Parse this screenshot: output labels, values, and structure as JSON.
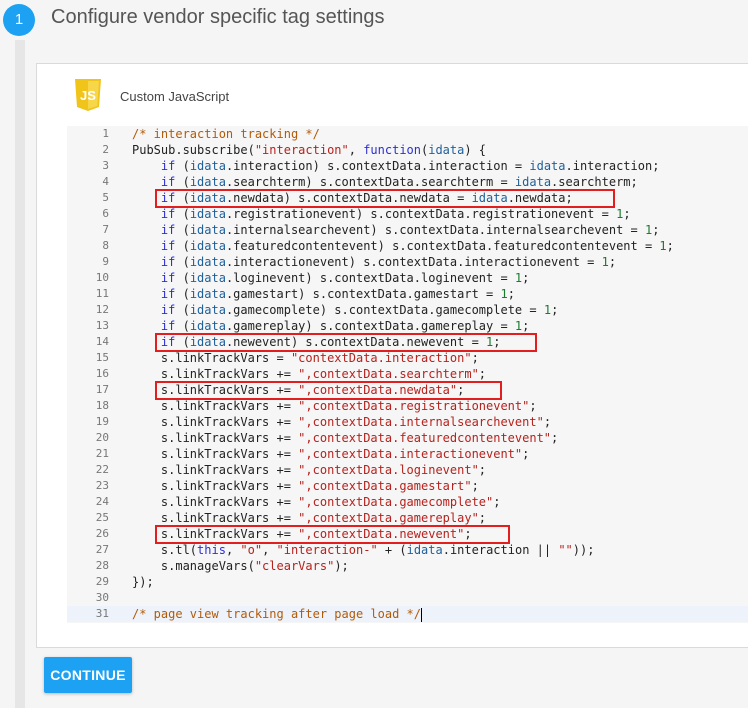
{
  "step": {
    "number": "1",
    "title": "Configure vendor specific tag settings"
  },
  "tag": {
    "icon": "javascript-file-icon",
    "logo_text": "JS",
    "label": "Custom JavaScript"
  },
  "editor": {
    "current_line": 31,
    "highlighted_lines": [
      5,
      14,
      17,
      26
    ],
    "lines": [
      {
        "n": "1",
        "segments": [
          {
            "t": "/* interaction tracking */",
            "c": "com"
          }
        ]
      },
      {
        "n": "2",
        "segments": [
          {
            "t": "PubSub.subscribe(",
            "c": "def"
          },
          {
            "t": "\"interaction\"",
            "c": "str"
          },
          {
            "t": ", ",
            "c": "def"
          },
          {
            "t": "function",
            "c": "kw"
          },
          {
            "t": "(",
            "c": "def"
          },
          {
            "t": "idata",
            "c": "var"
          },
          {
            "t": ") {",
            "c": "def"
          }
        ]
      },
      {
        "n": "3",
        "segments": [
          {
            "t": "    ",
            "c": "def"
          },
          {
            "t": "if",
            "c": "kw"
          },
          {
            "t": " (",
            "c": "def"
          },
          {
            "t": "idata",
            "c": "var"
          },
          {
            "t": ".interaction) s.contextData.interaction = ",
            "c": "def"
          },
          {
            "t": "idata",
            "c": "var"
          },
          {
            "t": ".interaction;",
            "c": "def"
          }
        ]
      },
      {
        "n": "4",
        "segments": [
          {
            "t": "    ",
            "c": "def"
          },
          {
            "t": "if",
            "c": "kw"
          },
          {
            "t": " (",
            "c": "def"
          },
          {
            "t": "idata",
            "c": "var"
          },
          {
            "t": ".searchterm) s.contextData.searchterm = ",
            "c": "def"
          },
          {
            "t": "idata",
            "c": "var"
          },
          {
            "t": ".searchterm;",
            "c": "def"
          }
        ]
      },
      {
        "n": "5",
        "segments": [
          {
            "t": "    ",
            "c": "def"
          },
          {
            "t": "if",
            "c": "kw"
          },
          {
            "t": " (",
            "c": "def"
          },
          {
            "t": "idata",
            "c": "var"
          },
          {
            "t": ".newdata) s.contextData.newdata = ",
            "c": "def"
          },
          {
            "t": "idata",
            "c": "var"
          },
          {
            "t": ".newdata;",
            "c": "def"
          }
        ]
      },
      {
        "n": "6",
        "segments": [
          {
            "t": "    ",
            "c": "def"
          },
          {
            "t": "if",
            "c": "kw"
          },
          {
            "t": " (",
            "c": "def"
          },
          {
            "t": "idata",
            "c": "var"
          },
          {
            "t": ".registrationevent) s.contextData.registrationevent = ",
            "c": "def"
          },
          {
            "t": "1",
            "c": "num"
          },
          {
            "t": ";",
            "c": "def"
          }
        ]
      },
      {
        "n": "7",
        "segments": [
          {
            "t": "    ",
            "c": "def"
          },
          {
            "t": "if",
            "c": "kw"
          },
          {
            "t": " (",
            "c": "def"
          },
          {
            "t": "idata",
            "c": "var"
          },
          {
            "t": ".internalsearchevent) s.contextData.internalsearchevent = ",
            "c": "def"
          },
          {
            "t": "1",
            "c": "num"
          },
          {
            "t": ";",
            "c": "def"
          }
        ]
      },
      {
        "n": "8",
        "segments": [
          {
            "t": "    ",
            "c": "def"
          },
          {
            "t": "if",
            "c": "kw"
          },
          {
            "t": " (",
            "c": "def"
          },
          {
            "t": "idata",
            "c": "var"
          },
          {
            "t": ".featuredcontentevent) s.contextData.featuredcontentevent = ",
            "c": "def"
          },
          {
            "t": "1",
            "c": "num"
          },
          {
            "t": ";",
            "c": "def"
          }
        ]
      },
      {
        "n": "9",
        "segments": [
          {
            "t": "    ",
            "c": "def"
          },
          {
            "t": "if",
            "c": "kw"
          },
          {
            "t": " (",
            "c": "def"
          },
          {
            "t": "idata",
            "c": "var"
          },
          {
            "t": ".interactionevent) s.contextData.interactionevent = ",
            "c": "def"
          },
          {
            "t": "1",
            "c": "num"
          },
          {
            "t": ";",
            "c": "def"
          }
        ]
      },
      {
        "n": "10",
        "segments": [
          {
            "t": "    ",
            "c": "def"
          },
          {
            "t": "if",
            "c": "kw"
          },
          {
            "t": " (",
            "c": "def"
          },
          {
            "t": "idata",
            "c": "var"
          },
          {
            "t": ".loginevent) s.contextData.loginevent = ",
            "c": "def"
          },
          {
            "t": "1",
            "c": "num"
          },
          {
            "t": ";",
            "c": "def"
          }
        ]
      },
      {
        "n": "11",
        "segments": [
          {
            "t": "    ",
            "c": "def"
          },
          {
            "t": "if",
            "c": "kw"
          },
          {
            "t": " (",
            "c": "def"
          },
          {
            "t": "idata",
            "c": "var"
          },
          {
            "t": ".gamestart) s.contextData.gamestart = ",
            "c": "def"
          },
          {
            "t": "1",
            "c": "num"
          },
          {
            "t": ";",
            "c": "def"
          }
        ]
      },
      {
        "n": "12",
        "segments": [
          {
            "t": "    ",
            "c": "def"
          },
          {
            "t": "if",
            "c": "kw"
          },
          {
            "t": " (",
            "c": "def"
          },
          {
            "t": "idata",
            "c": "var"
          },
          {
            "t": ".gamecomplete) s.contextData.gamecomplete = ",
            "c": "def"
          },
          {
            "t": "1",
            "c": "num"
          },
          {
            "t": ";",
            "c": "def"
          }
        ]
      },
      {
        "n": "13",
        "segments": [
          {
            "t": "    ",
            "c": "def"
          },
          {
            "t": "if",
            "c": "kw"
          },
          {
            "t": " (",
            "c": "def"
          },
          {
            "t": "idata",
            "c": "var"
          },
          {
            "t": ".gamereplay) s.contextData.gamereplay = ",
            "c": "def"
          },
          {
            "t": "1",
            "c": "num"
          },
          {
            "t": ";",
            "c": "def"
          }
        ]
      },
      {
        "n": "14",
        "segments": [
          {
            "t": "    ",
            "c": "def"
          },
          {
            "t": "if",
            "c": "kw"
          },
          {
            "t": " (",
            "c": "def"
          },
          {
            "t": "idata",
            "c": "var"
          },
          {
            "t": ".newevent) s.contextData.newevent = ",
            "c": "def"
          },
          {
            "t": "1",
            "c": "num"
          },
          {
            "t": ";",
            "c": "def"
          }
        ]
      },
      {
        "n": "15",
        "segments": [
          {
            "t": "    s.linkTrackVars = ",
            "c": "def"
          },
          {
            "t": "\"contextData.interaction\"",
            "c": "str"
          },
          {
            "t": ";",
            "c": "def"
          }
        ]
      },
      {
        "n": "16",
        "segments": [
          {
            "t": "    s.linkTrackVars += ",
            "c": "def"
          },
          {
            "t": "\",contextData.searchterm\"",
            "c": "str"
          },
          {
            "t": ";",
            "c": "def"
          }
        ]
      },
      {
        "n": "17",
        "segments": [
          {
            "t": "    s.linkTrackVars += ",
            "c": "def"
          },
          {
            "t": "\",contextData.newdata\"",
            "c": "str"
          },
          {
            "t": ";",
            "c": "def"
          }
        ]
      },
      {
        "n": "18",
        "segments": [
          {
            "t": "    s.linkTrackVars += ",
            "c": "def"
          },
          {
            "t": "\",contextData.registrationevent\"",
            "c": "str"
          },
          {
            "t": ";",
            "c": "def"
          }
        ]
      },
      {
        "n": "19",
        "segments": [
          {
            "t": "    s.linkTrackVars += ",
            "c": "def"
          },
          {
            "t": "\",contextData.internalsearchevent\"",
            "c": "str"
          },
          {
            "t": ";",
            "c": "def"
          }
        ]
      },
      {
        "n": "20",
        "segments": [
          {
            "t": "    s.linkTrackVars += ",
            "c": "def"
          },
          {
            "t": "\",contextData.featuredcontentevent\"",
            "c": "str"
          },
          {
            "t": ";",
            "c": "def"
          }
        ]
      },
      {
        "n": "21",
        "segments": [
          {
            "t": "    s.linkTrackVars += ",
            "c": "def"
          },
          {
            "t": "\",contextData.interactionevent\"",
            "c": "str"
          },
          {
            "t": ";",
            "c": "def"
          }
        ]
      },
      {
        "n": "22",
        "segments": [
          {
            "t": "    s.linkTrackVars += ",
            "c": "def"
          },
          {
            "t": "\",contextData.loginevent\"",
            "c": "str"
          },
          {
            "t": ";",
            "c": "def"
          }
        ]
      },
      {
        "n": "23",
        "segments": [
          {
            "t": "    s.linkTrackVars += ",
            "c": "def"
          },
          {
            "t": "\",contextData.gamestart\"",
            "c": "str"
          },
          {
            "t": ";",
            "c": "def"
          }
        ]
      },
      {
        "n": "24",
        "segments": [
          {
            "t": "    s.linkTrackVars += ",
            "c": "def"
          },
          {
            "t": "\",contextData.gamecomplete\"",
            "c": "str"
          },
          {
            "t": ";",
            "c": "def"
          }
        ]
      },
      {
        "n": "25",
        "segments": [
          {
            "t": "    s.linkTrackVars += ",
            "c": "def"
          },
          {
            "t": "\",contextData.gamereplay\"",
            "c": "str"
          },
          {
            "t": ";",
            "c": "def"
          }
        ]
      },
      {
        "n": "26",
        "segments": [
          {
            "t": "    s.linkTrackVars += ",
            "c": "def"
          },
          {
            "t": "\",contextData.newevent\"",
            "c": "str"
          },
          {
            "t": ";",
            "c": "def"
          }
        ]
      },
      {
        "n": "27",
        "segments": [
          {
            "t": "    s.tl(",
            "c": "def"
          },
          {
            "t": "this",
            "c": "kw"
          },
          {
            "t": ", ",
            "c": "def"
          },
          {
            "t": "\"o\"",
            "c": "str"
          },
          {
            "t": ", ",
            "c": "def"
          },
          {
            "t": "\"interaction-\"",
            "c": "str"
          },
          {
            "t": " + (",
            "c": "def"
          },
          {
            "t": "idata",
            "c": "var"
          },
          {
            "t": ".interaction || ",
            "c": "def"
          },
          {
            "t": "\"\"",
            "c": "str"
          },
          {
            "t": "));",
            "c": "def"
          }
        ]
      },
      {
        "n": "28",
        "segments": [
          {
            "t": "    s.manageVars(",
            "c": "def"
          },
          {
            "t": "\"clearVars\"",
            "c": "str"
          },
          {
            "t": ");",
            "c": "def"
          }
        ]
      },
      {
        "n": "29",
        "segments": [
          {
            "t": "});",
            "c": "def"
          }
        ]
      },
      {
        "n": "30",
        "segments": []
      },
      {
        "n": "31",
        "segments": [
          {
            "t": "/* page view tracking after page load */",
            "c": "com"
          }
        ]
      }
    ]
  },
  "actions": {
    "continue_label": "CONTINUE"
  },
  "colors": {
    "accent": "#1da1f2",
    "highlight_box": "#e31e1e",
    "syntax": {
      "def": "#222222",
      "kw": "#2b2fd1",
      "var": "#1e5f9a",
      "str": "#b5221d",
      "com": "#b35a07",
      "num": "#1a7a2e"
    }
  }
}
